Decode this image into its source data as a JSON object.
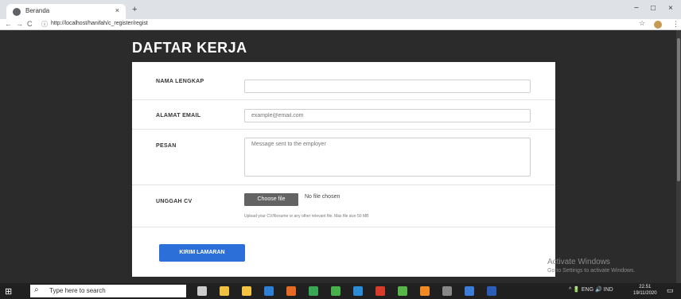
{
  "browser": {
    "tab_title": "Beranda",
    "tab_close": "×",
    "new_tab": "+",
    "url": "http://localhost/hanifah/c_register/regist",
    "info_icon": "ⓘ",
    "nav": {
      "back": "←",
      "forward": "→",
      "reload": "C"
    },
    "window": {
      "minimize": "−",
      "maximize": "□",
      "close": "×"
    },
    "star": "☆",
    "menu": "⋮"
  },
  "form": {
    "heading": "DAFTAR KERJA",
    "name_label": "NAMA LENGKAP",
    "name_value": "",
    "email_label": "ALAMAT EMAIL",
    "email_placeholder": "example@email.com",
    "message_label": "PESAN",
    "message_placeholder": "Message sent to the employer",
    "cv_label": "UNGGAH CV",
    "file_button": "Choose file",
    "file_status": "No file chosen",
    "file_help": "Upload your CV/Resume or any other relevant file. Max file size 50 MB",
    "submit": "KIRIM LAMARAN"
  },
  "watermark": {
    "title": "Activate Windows",
    "subtitle": "Go to Settings to activate Windows."
  },
  "taskbar": {
    "start_icon": "windows-icon",
    "search_placeholder": "Type here to search",
    "tray_text": "^ 🔋 ENG 🔊 IND",
    "time": "22.51",
    "date": "19/11/2020",
    "apps": [
      {
        "name": "task-view-icon",
        "color": "#cccccc"
      },
      {
        "name": "file-explorer-icon",
        "color": "#f0c040"
      },
      {
        "name": "store-icon",
        "color": "#f5c242"
      },
      {
        "name": "mail-icon",
        "color": "#2d7fd6"
      },
      {
        "name": "firefox-icon",
        "color": "#e66a24"
      },
      {
        "name": "chrome-icon",
        "color": "#3aa757"
      },
      {
        "name": "maps-icon",
        "color": "#47b04b"
      },
      {
        "name": "edge-icon",
        "color": "#2a8bd6"
      },
      {
        "name": "xampp-icon",
        "color": "#d73b2b"
      },
      {
        "name": "qgis-icon",
        "color": "#58b54a"
      },
      {
        "name": "app-orange-icon",
        "color": "#f08a24"
      },
      {
        "name": "app-gray-icon",
        "color": "#888888"
      },
      {
        "name": "chrome-active-icon",
        "color": "#3b7dd8"
      },
      {
        "name": "word-icon",
        "color": "#2b5cb8"
      }
    ]
  }
}
